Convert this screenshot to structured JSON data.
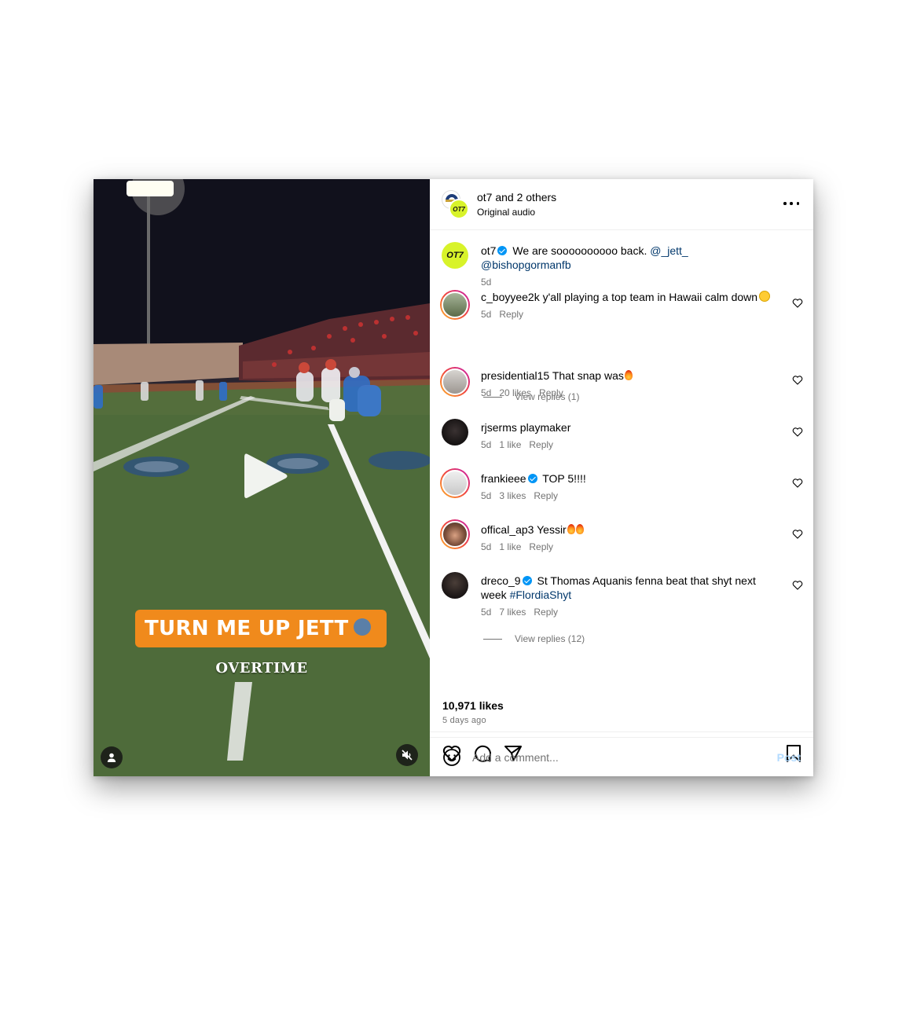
{
  "header": {
    "title": "ot7 and 2 others",
    "subtitle": "Original audio",
    "avatar_label": "OT7"
  },
  "video": {
    "caption": "TURN ME UP JETT",
    "subcaption": "OVERTIME"
  },
  "post_caption": {
    "user": "ot7",
    "verified": true,
    "avatar_label": "OT7",
    "text": "We are soooooooooo back.",
    "mentions": [
      "@_jett_",
      "@bishopgormanfb"
    ],
    "time": "5d"
  },
  "comments": [
    {
      "user": "c_boyyee2k",
      "verified": false,
      "text": "y'all playing a top team in Hawaii calm down",
      "time": "5d",
      "likes": "",
      "reply": "Reply",
      "view_replies": "View replies (1)"
    },
    {
      "user": "presidential15",
      "verified": false,
      "text": "That snap was",
      "time": "5d",
      "likes": "20 likes",
      "reply": "Reply",
      "view_replies": ""
    },
    {
      "user": "rjserms",
      "verified": false,
      "text": "playmaker",
      "time": "5d",
      "likes": "1 like",
      "reply": "Reply",
      "view_replies": ""
    },
    {
      "user": "frankieee",
      "verified": true,
      "text": "TOP 5!!!!",
      "time": "5d",
      "likes": "3 likes",
      "reply": "Reply",
      "view_replies": ""
    },
    {
      "user": "offical_ap3",
      "verified": false,
      "text": "Yessir",
      "time": "5d",
      "likes": "1 like",
      "reply": "Reply",
      "view_replies": ""
    },
    {
      "user": "dreco_9",
      "verified": true,
      "text": "St Thomas Aquanis fenna beat that shyt next week",
      "hashtag": "#FlordiaShyt",
      "time": "5d",
      "likes": "7 likes",
      "reply": "Reply",
      "view_replies": "View replies (12)"
    }
  ],
  "footer": {
    "likes": "10,971 likes",
    "posted_ago": "5 days ago",
    "comment_placeholder": "Add a comment...",
    "post_label": "Post"
  },
  "colors": {
    "accent": "#0095f6",
    "mention": "#00376b",
    "caption_orange": "#f08a1c",
    "ot7_green": "#d8f32a",
    "muted": "#737373"
  },
  "icons": [
    "play-icon",
    "user-tag-icon",
    "mute-icon",
    "more-icon",
    "heart-icon",
    "comment-icon",
    "share-icon",
    "bookmark-icon",
    "emoji-icon",
    "verified-icon"
  ]
}
